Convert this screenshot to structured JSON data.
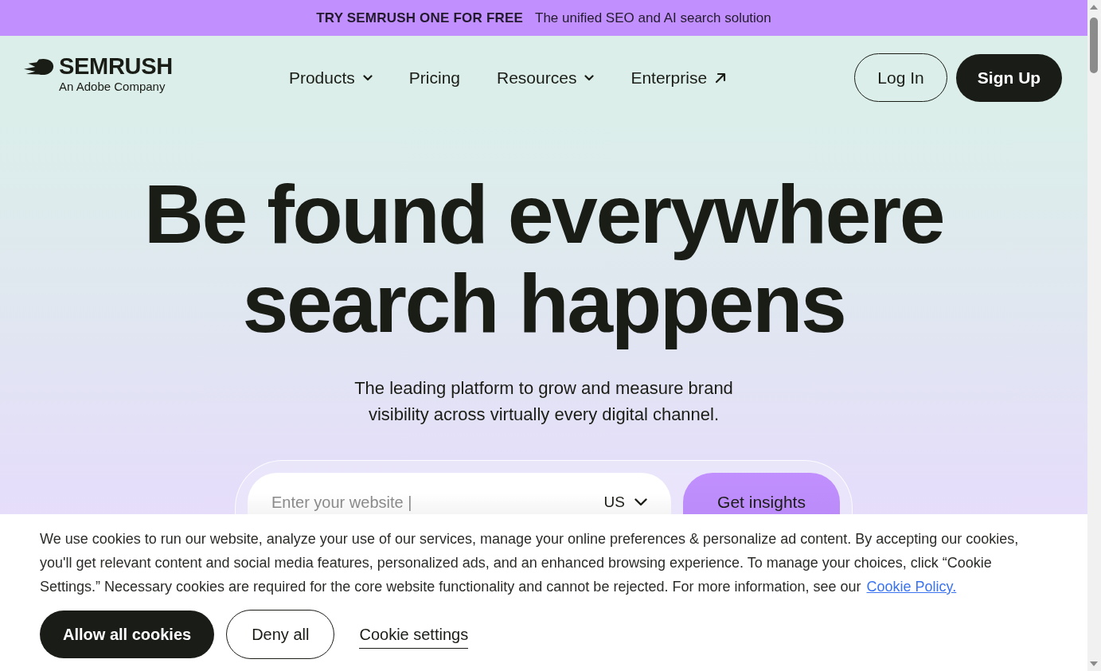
{
  "promo_bar": {
    "headline": "TRY SEMRUSH ONE FOR FREE",
    "text": "The unified SEO and AI search solution"
  },
  "header": {
    "logo": {
      "name": "SEMRUSH",
      "tagline": "An Adobe Company"
    },
    "nav": [
      {
        "label": "Products",
        "kind": "dropdown"
      },
      {
        "label": "Pricing",
        "kind": "link"
      },
      {
        "label": "Resources",
        "kind": "dropdown"
      },
      {
        "label": "Enterprise",
        "kind": "external"
      }
    ],
    "buttons": [
      {
        "label": "Log In",
        "kind": "outline"
      },
      {
        "label": "Sign Up",
        "kind": "filled"
      }
    ]
  },
  "hero": {
    "title": "Be found everywhere search happens",
    "subtitle": "The leading platform to grow and measure brand visibility across virtually every digital channel.",
    "search": {
      "placeholder": "Enter your website |",
      "country": "US",
      "button": "Get insights"
    }
  },
  "cookie_banner": {
    "text": "We use cookies to run our website, analyze your use of our services, manage your online preferences & personalize ad content. By accepting our cookies, you'll get relevant content and social media features, personalized ads, and an enhanced browsing experience. To manage your choices, click “Cookie Settings.” Necessary cookies are required for the core website functionality and cannot be rejected. For more information, see our",
    "link": "Cookie Policy.",
    "buttons": [
      {
        "label": "Allow all cookies",
        "kind": "filled"
      },
      {
        "label": "Deny all",
        "kind": "outline"
      },
      {
        "label": "Cookie settings",
        "kind": "link"
      }
    ]
  }
}
